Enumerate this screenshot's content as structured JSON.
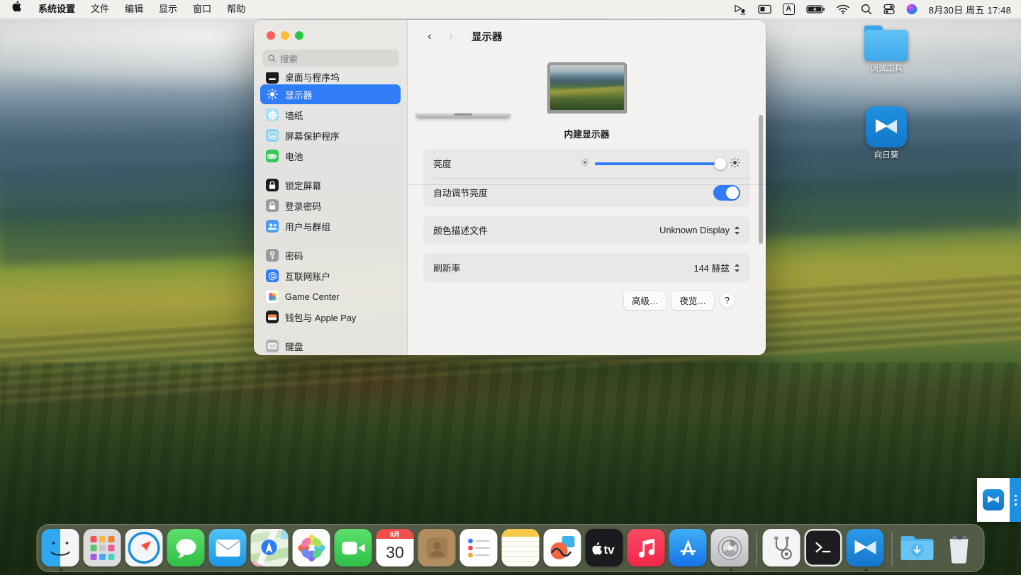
{
  "menubar": {
    "apple_icon": "apple-logo-icon",
    "items": [
      {
        "label": "系统设置",
        "bold": true
      },
      {
        "label": "文件",
        "bold": false
      },
      {
        "label": "编辑",
        "bold": false
      },
      {
        "label": "显示",
        "bold": false
      },
      {
        "label": "窗口",
        "bold": false
      },
      {
        "label": "帮助",
        "bold": false
      }
    ],
    "status_icons": [
      {
        "name": "screen-sharing-icon"
      },
      {
        "name": "screen-mirroring-icon"
      },
      {
        "name": "input-method-icon",
        "label": "A"
      },
      {
        "name": "battery-charging-icon"
      },
      {
        "name": "wifi-icon"
      },
      {
        "name": "spotlight-search-icon"
      },
      {
        "name": "control-center-icon"
      },
      {
        "name": "siri-icon"
      }
    ],
    "clock": "8月30日 周五  17:48"
  },
  "desktop_icons": [
    {
      "label": "调试工具",
      "type": "folder"
    },
    {
      "label": "向日葵",
      "type": "app"
    }
  ],
  "window": {
    "title": "显示器",
    "nav": {
      "back": "‹",
      "forward": "›"
    },
    "search": {
      "placeholder": "搜索",
      "value": ""
    },
    "sidebar": {
      "clipped_top_item": "桌面与程序坞",
      "groups": [
        {
          "items": [
            {
              "label": "显示器",
              "icon": "brightness-icon",
              "color": "#2f7cf6",
              "selected": true
            },
            {
              "label": "墙纸",
              "icon": "wallpaper-icon",
              "color": "#5ac8f5",
              "selected": false
            },
            {
              "label": "屏幕保护程序",
              "icon": "screensaver-icon",
              "color": "#5ac8f5",
              "selected": false
            },
            {
              "label": "电池",
              "icon": "battery-icon",
              "color": "#34c759",
              "selected": false
            }
          ]
        },
        {
          "items": [
            {
              "label": "锁定屏幕",
              "icon": "lock-screen-icon",
              "color": "#1c1c1e",
              "selected": false
            },
            {
              "label": "登录密码",
              "icon": "password-lock-icon",
              "color": "#8e8e93",
              "selected": false
            },
            {
              "label": "用户与群组",
              "icon": "users-groups-icon",
              "color": "#2f7cf6",
              "selected": false
            }
          ]
        },
        {
          "items": [
            {
              "label": "密码",
              "icon": "key-icon",
              "color": "#8e8e93",
              "selected": false
            },
            {
              "label": "互联网账户",
              "icon": "at-sign-icon",
              "color": "#2f7cf6",
              "selected": false
            },
            {
              "label": "Game Center",
              "icon": "game-center-icon",
              "color": "#ffffff",
              "selected": false
            },
            {
              "label": "钱包与 Apple Pay",
              "icon": "wallet-icon",
              "color": "#1c1c1e",
              "selected": false
            }
          ]
        },
        {
          "items": [
            {
              "label": "键盘",
              "icon": "keyboard-icon",
              "color": "#b6b6ba",
              "selected": false
            }
          ]
        }
      ]
    },
    "display": {
      "hero_label": "内建显示器",
      "rows": [
        {
          "label": "亮度",
          "type": "slider",
          "value": 97,
          "min_icon": "brightness-low-icon",
          "max_icon": "brightness-high-icon"
        },
        {
          "label": "自动调节亮度",
          "type": "toggle",
          "value": true
        },
        {
          "label": "颜色描述文件",
          "type": "popup",
          "value": "Unknown Display"
        },
        {
          "label": "刷新率",
          "type": "popup",
          "value": "144 赫兹"
        }
      ],
      "buttons": [
        {
          "label": "高级…"
        },
        {
          "label": "夜览…"
        },
        {
          "label": "?",
          "name": "help"
        }
      ]
    }
  },
  "float_widget": {
    "app": "向日葵",
    "menu_icon": "more-vertical-icon"
  },
  "dock": {
    "items": [
      {
        "name": "finder",
        "label": "访达",
        "running": true
      },
      {
        "name": "launchpad",
        "label": "启动台",
        "running": false
      },
      {
        "name": "safari",
        "label": "Safari 浏览器",
        "running": false
      },
      {
        "name": "messages",
        "label": "信息",
        "running": false
      },
      {
        "name": "mail",
        "label": "邮件",
        "running": false
      },
      {
        "name": "maps",
        "label": "地图",
        "running": false
      },
      {
        "name": "photos",
        "label": "照片",
        "running": false
      },
      {
        "name": "facetime",
        "label": "FaceTime 通话",
        "running": false
      },
      {
        "name": "calendar",
        "label": "日历",
        "running": false,
        "month": "8月",
        "day": "30"
      },
      {
        "name": "contacts",
        "label": "通讯录",
        "running": false
      },
      {
        "name": "reminders",
        "label": "提醒事项",
        "running": false
      },
      {
        "name": "notes",
        "label": "备忘录",
        "running": false
      },
      {
        "name": "freeform",
        "label": "无边记",
        "running": false
      },
      {
        "name": "appletv",
        "label": "Apple TV",
        "running": false
      },
      {
        "name": "music",
        "label": "音乐",
        "running": false
      },
      {
        "name": "appstore",
        "label": "App Store",
        "running": false
      },
      {
        "name": "system-settings",
        "label": "系统设置",
        "running": true
      },
      {
        "name": "activity-monitor",
        "label": "活动监视器",
        "running": false
      },
      {
        "name": "terminal",
        "label": "终端",
        "running": false
      },
      {
        "name": "sunflower",
        "label": "向日葵",
        "running": true
      }
    ],
    "trailing": [
      {
        "name": "downloads-folder",
        "label": "下载"
      },
      {
        "name": "trash",
        "label": "废纸篓"
      }
    ]
  },
  "colors": {
    "accent": "#2f7cf6",
    "selection": "#2f7cf6",
    "toggle_on": "#2f7cf6",
    "window_bg": "#f3f2f0",
    "sidebar_bg": "#e9e8e5",
    "card_bg": "#e9e8e6"
  }
}
